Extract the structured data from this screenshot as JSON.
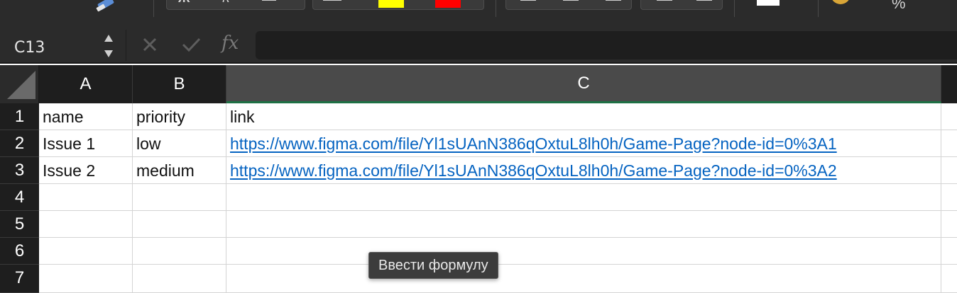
{
  "ribbon": {
    "brush_icon": "format-painter-icon",
    "bold_glyph": "Ж",
    "italic_glyph": "К",
    "percent_glyph": "%",
    "highlight_color": "#ffff00",
    "font_color": "#ff0000"
  },
  "formula_bar": {
    "name_box": "C13",
    "cancel_icon": "x-icon",
    "enter_icon": "check-icon",
    "fx_label": "fx",
    "formula_value": ""
  },
  "columns": [
    {
      "label": "A",
      "selected": false
    },
    {
      "label": "B",
      "selected": false
    },
    {
      "label": "C",
      "selected": true
    }
  ],
  "rows": [
    {
      "num": "1",
      "a": "name",
      "b": "priority",
      "c": "link",
      "c_is_link": false
    },
    {
      "num": "2",
      "a": "Issue 1",
      "b": "low",
      "c": "https://www.figma.com/file/Yl1sUAnN386qOxtuL8lh0h/Game-Page?node-id=0%3A1",
      "c_is_link": true
    },
    {
      "num": "3",
      "a": "Issue 2",
      "b": "medium",
      "c": "https://www.figma.com/file/Yl1sUAnN386qOxtuL8lh0h/Game-Page?node-id=0%3A2",
      "c_is_link": true
    },
    {
      "num": "4",
      "a": "",
      "b": "",
      "c": "",
      "c_is_link": false
    },
    {
      "num": "5",
      "a": "",
      "b": "",
      "c": "",
      "c_is_link": false
    },
    {
      "num": "6",
      "a": "",
      "b": "",
      "c": "",
      "c_is_link": false
    },
    {
      "num": "7",
      "a": "",
      "b": "",
      "c": "",
      "c_is_link": false
    }
  ],
  "tooltip": {
    "text": "Ввести формулу"
  },
  "colors": {
    "link": "#0563c1",
    "selected_col_accent": "#1e7145"
  }
}
